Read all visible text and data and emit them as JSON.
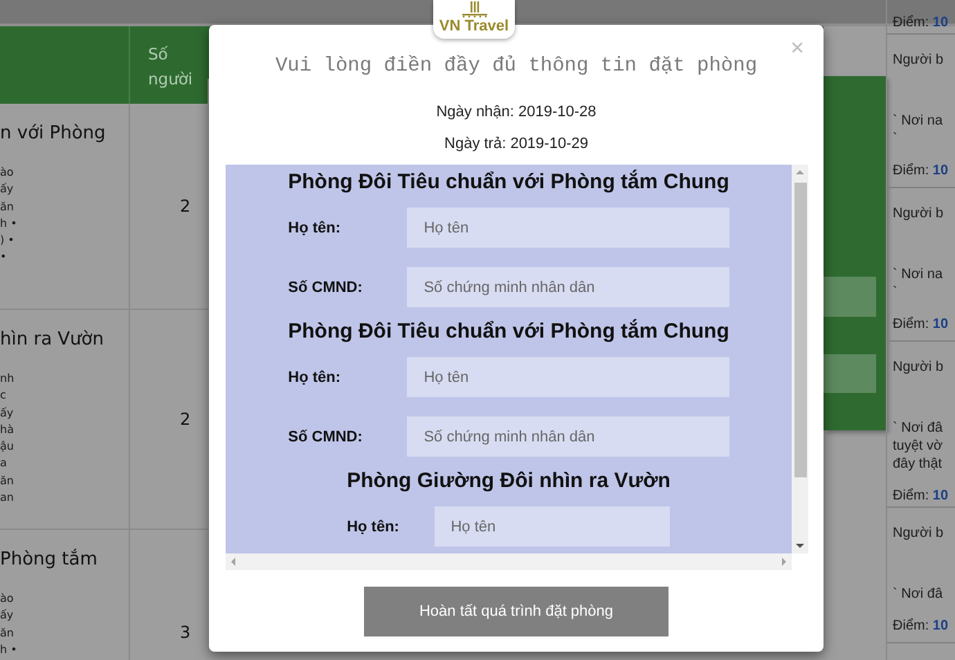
{
  "table": {
    "guests_header": "Số\nngười",
    "rows": [
      {
        "room": "n với Phòng",
        "amenities": [
          "ào",
          "ấy",
          "ăn",
          "h •",
          ") •",
          "•"
        ],
        "guests": "2"
      },
      {
        "room": "hìn ra Vườn",
        "amenities": [
          "nh",
          "c",
          "ấy",
          "hà",
          "ậu",
          "a",
          "ăn",
          "an"
        ],
        "guests": "2"
      },
      {
        "room": "Phòng tắm",
        "amenities": [
          "ào",
          "ấy",
          "ăn",
          "h •"
        ],
        "guests": "3"
      }
    ]
  },
  "reviews": [
    {
      "score_label": "Điểm:",
      "score": "10"
    },
    {
      "reviewer": "Người b",
      "comment": [
        "` Nơi na",
        "`"
      ],
      "score_label": "Điểm:",
      "score": "10"
    },
    {
      "reviewer": "Người b",
      "comment": [
        "` Nơi na",
        "`"
      ],
      "score_label": "Điểm:",
      "score": "10"
    },
    {
      "reviewer": "Người b",
      "comment": [
        "` Nơi đâ",
        "tuyệt vờ",
        "đây thật"
      ],
      "score_label": "Điểm:",
      "score": "10"
    },
    {
      "reviewer": "Người b",
      "comment": [
        "` Nơi đâ"
      ],
      "score_label": "Điểm:",
      "score": "10"
    }
  ],
  "modal": {
    "logo": "VN Travel",
    "close": "×",
    "title": "Vui lòng điền đầy đủ thông tin đặt phòng",
    "check_in": "Ngày nhận: 2019-10-28",
    "check_out": "Ngày trả: 2019-10-29",
    "rooms": [
      {
        "name": "Phòng Đôi Tiêu chuẩn với Phòng tắm Chung",
        "fields": [
          {
            "label": "Họ tên:",
            "placeholder": "Họ tên"
          },
          {
            "label": "Số CMND:",
            "placeholder": "Số chứng minh nhân dân"
          }
        ]
      },
      {
        "name": "Phòng Đôi Tiêu chuẩn với Phòng tắm Chung",
        "fields": [
          {
            "label": "Họ tên:",
            "placeholder": "Họ tên"
          },
          {
            "label": "Số CMND:",
            "placeholder": "Số chứng minh nhân dân"
          }
        ]
      },
      {
        "name": "Phòng Giường Đôi nhìn ra Vườn",
        "fields": [
          {
            "label": "Họ tên:",
            "placeholder": "Họ tên"
          }
        ]
      }
    ],
    "submit": "Hoàn tất quá trình đặt phòng"
  }
}
